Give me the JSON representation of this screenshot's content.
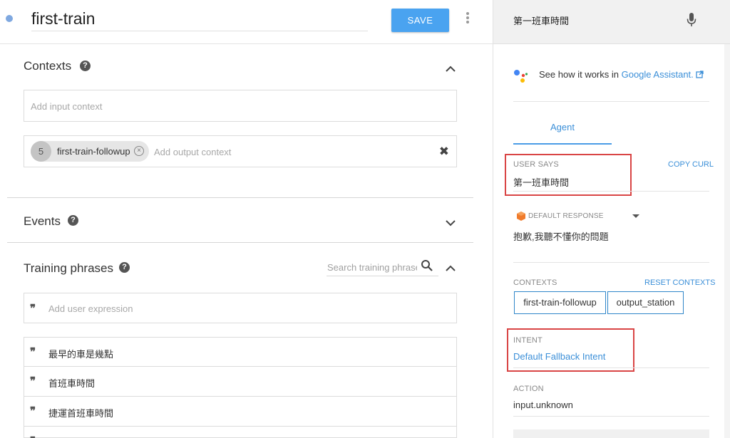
{
  "editor": {
    "intent_name": "first-train",
    "save_label": "SAVE"
  },
  "contexts": {
    "title": "Contexts",
    "input_placeholder": "Add input context",
    "output_chip_lifespan": "5",
    "output_chip_label": "first-train-followup",
    "output_placeholder": "Add output context"
  },
  "events": {
    "title": "Events"
  },
  "training": {
    "title": "Training phrases",
    "search_placeholder": "Search training phrases",
    "add_placeholder": "Add user expression",
    "phrases": [
      "最早的車是幾點",
      "首班車時間",
      "捷運首班車時間"
    ]
  },
  "test_console": {
    "query": "第一班車時間",
    "ga_prefix": "See how it works in ",
    "ga_link": "Google Assistant.",
    "agent_tab": "Agent",
    "user_says_label": "USER SAYS",
    "copy_curl": "COPY CURL",
    "user_says_value": "第一班車時間",
    "default_response_label": "DEFAULT RESPONSE",
    "response_text": "抱歉,我聽不懂你的問題",
    "contexts_label": "CONTEXTS",
    "reset_contexts": "RESET CONTEXTS",
    "context_chips": [
      "first-train-followup",
      "output_station"
    ],
    "intent_label": "INTENT",
    "intent_value": "Default Fallback Intent",
    "action_label": "ACTION",
    "action_value": "input.unknown"
  },
  "colors": {
    "accent": "#4aa3f0",
    "link": "#3b8fd8",
    "highlight_border": "#d94545"
  }
}
